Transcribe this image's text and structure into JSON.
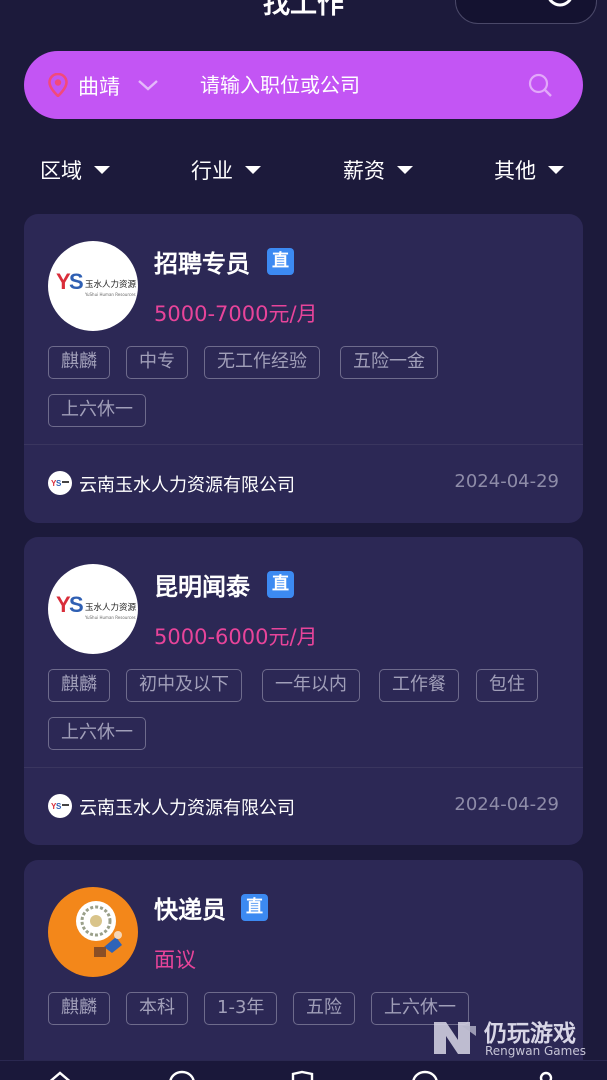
{
  "header": {
    "title": "找工作",
    "capsule": {
      "more_icon": "menu-dot-icon",
      "close_icon": "target-icon"
    }
  },
  "search": {
    "location_icon": "location-pin-icon",
    "city": "曲靖",
    "placeholder": "请输入职位或公司",
    "search_icon": "search-icon"
  },
  "filters": [
    {
      "label": "区域"
    },
    {
      "label": "行业"
    },
    {
      "label": "薪资"
    },
    {
      "label": "其他"
    }
  ],
  "jobs": [
    {
      "title": "招聘专员",
      "badge": "直",
      "salary": "5000-7000元/月",
      "tags": [
        "麒麟",
        "中专",
        "无工作经验",
        "五险一金",
        "上六休一"
      ],
      "company": "云南玉水人力资源有限公司",
      "date": "2024-04-29",
      "logo_text": "玉水人力资源",
      "logo_sub": "YuShui Human Resources"
    },
    {
      "title": "昆明闻泰",
      "badge": "直",
      "salary": "5000-6000元/月",
      "tags": [
        "麒麟",
        "初中及以下",
        "一年以内",
        "工作餐",
        "包住",
        "上六休一"
      ],
      "company": "云南玉水人力资源有限公司",
      "date": "2024-04-29",
      "logo_text": "玉水人力资源",
      "logo_sub": "YuShui Human Resources"
    },
    {
      "title": "快递员",
      "badge": "直",
      "salary": "面议",
      "tags": [
        "麒麟",
        "本科",
        "1-3年",
        "五险",
        "上六休一"
      ]
    }
  ],
  "watermark": {
    "title": "仍玩游戏",
    "subtitle": "Rengwan Games"
  },
  "colors": {
    "background": "#1c1a3b",
    "card": "#2c2855",
    "search_bar": "#c355f4",
    "salary": "#e8449a",
    "badge": "#3c8af2"
  }
}
